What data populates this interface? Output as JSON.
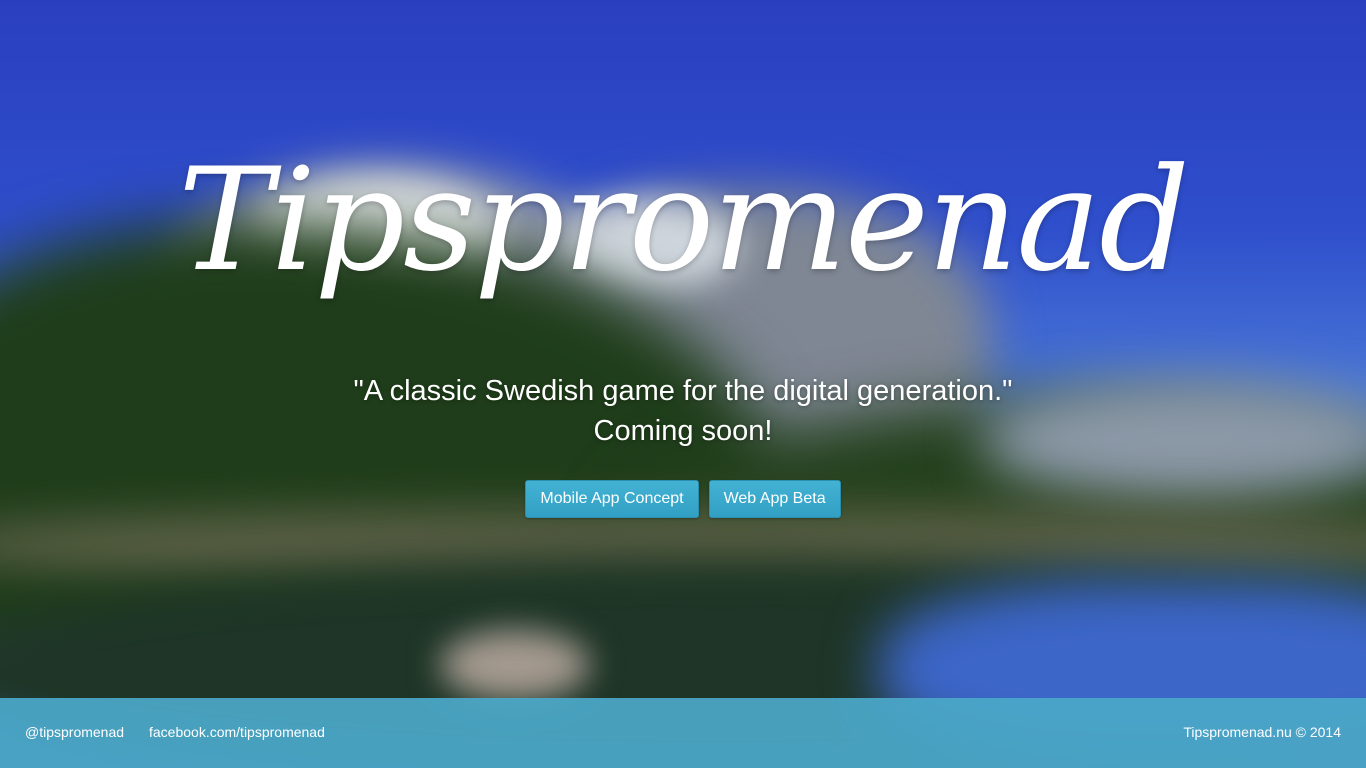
{
  "hero": {
    "logo": "Tipspromenad",
    "tagline_line1": "\"A classic Swedish game for the digital generation.\"",
    "tagline_line2": "Coming soon!"
  },
  "buttons": {
    "mobile_app": "Mobile App Concept",
    "web_app": "Web App Beta"
  },
  "footer": {
    "twitter": "@tipspromenad",
    "facebook": "facebook.com/tipspromenad",
    "copyright": "Tipspromenad.nu © 2014"
  },
  "colors": {
    "button": "#39a8cb",
    "footer": "#4aa8c8",
    "sky": "#2a3fc0"
  }
}
